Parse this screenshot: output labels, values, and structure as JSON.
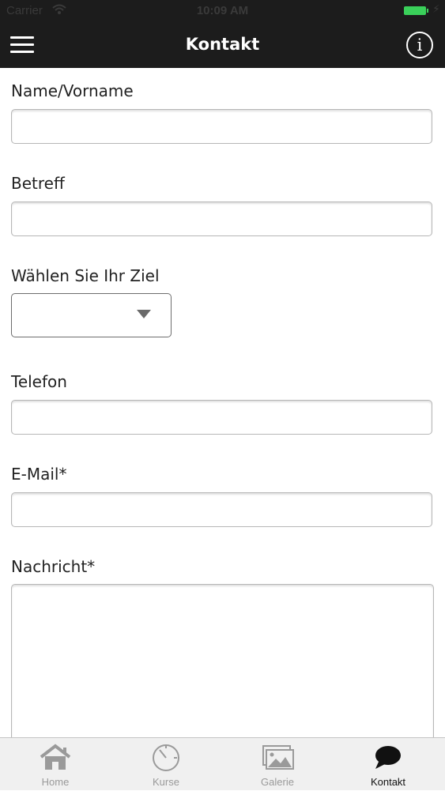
{
  "status_bar": {
    "carrier": "Carrier",
    "time": "10:09 AM"
  },
  "navbar": {
    "title": "Kontakt",
    "menu_icon": "hamburger-menu-icon",
    "info_icon": "info-icon",
    "info_glyph": "i"
  },
  "form": {
    "fields": [
      {
        "label": "Name/Vorname",
        "value": ""
      },
      {
        "label": "Betreff",
        "value": ""
      },
      {
        "label": "Wählen Sie Ihr Ziel",
        "value": ""
      },
      {
        "label": "Telefon",
        "value": ""
      },
      {
        "label": "E-Mail*",
        "value": ""
      },
      {
        "label": "Nachricht*",
        "value": ""
      }
    ]
  },
  "tabbar": {
    "active": "Kontakt",
    "tabs": [
      {
        "label": "Home",
        "icon": "home-icon"
      },
      {
        "label": "Kurse",
        "icon": "timer-icon"
      },
      {
        "label": "Galerie",
        "icon": "gallery-icon"
      },
      {
        "label": "Kontakt",
        "icon": "chat-bubble-icon"
      }
    ]
  }
}
